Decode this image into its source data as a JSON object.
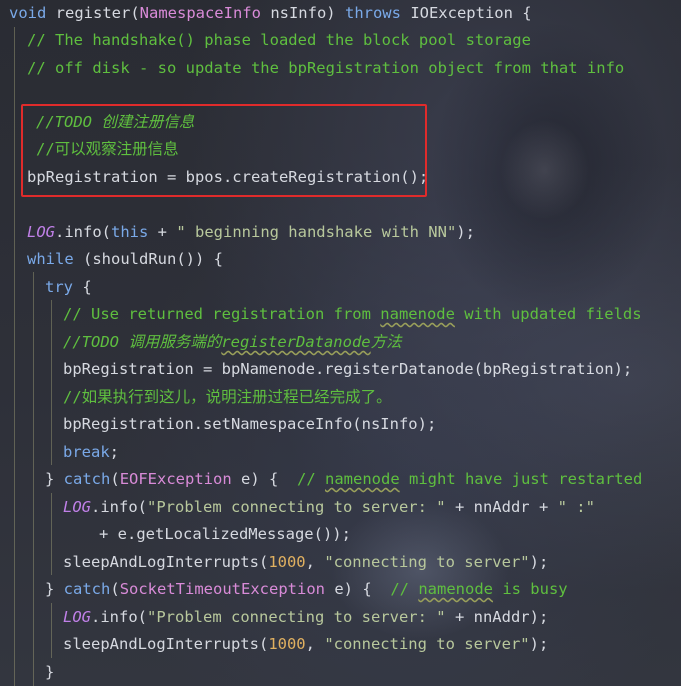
{
  "colors": {
    "background": "#2b2d36",
    "keyword": "#7aa9e8",
    "comment": "#5fbf3f",
    "type": "#d98bd8",
    "string": "#b8c89c",
    "number": "#e0b060",
    "field": "#c080e8",
    "highlight_box": "#e02b2b"
  },
  "code": {
    "l1": {
      "kw_void": "void",
      "name": " register(",
      "type": "NamespaceInfo",
      "param": " nsInfo) ",
      "kw_throws": "throws",
      "exc": " IOException {"
    },
    "l2": {
      "comment": "// The handshake() phase loaded the block pool storage"
    },
    "l3": {
      "comment": "// off disk - so update the bpRegistration object from that info"
    },
    "l4": {
      "comment": "//TODO 创建注册信息"
    },
    "l5": {
      "comment": "//可以观察注册信息"
    },
    "l6": {
      "code": "bpRegistration = bpos.createRegistration();"
    },
    "l7": {
      "field": "LOG",
      "a": ".info(",
      "kw_this": "this",
      "b": " + ",
      "str": "\" beginning handshake with NN\"",
      "c": ");"
    },
    "l8": {
      "kw": "while",
      "rest": " (shouldRun()) {"
    },
    "l9": {
      "kw": "try",
      "rest": " {"
    },
    "l10": {
      "c1": "// Use returned registration from ",
      "c2": "namenode",
      "c3": " with updated fields"
    },
    "l11": {
      "c1": "//TODO 调用服务端的",
      "c2": "registerDatanode",
      "c3": "方法"
    },
    "l12": {
      "code": "bpRegistration = bpNamenode.registerDatanode(bpRegistration);"
    },
    "l13": {
      "comment": "//如果执行到这儿，说明注册过程已经完成了。"
    },
    "l14": {
      "code": "bpRegistration.setNamespaceInfo(nsInfo);"
    },
    "l15": {
      "kw": "break",
      "rest": ";"
    },
    "l16": {
      "a": "} ",
      "kw": "catch",
      "b": "(",
      "type": "EOFException",
      "c": " e) {  ",
      "c1": "// ",
      "c2": "namenode",
      "c3": " might have just restarted"
    },
    "l17": {
      "field": "LOG",
      "a": ".info(",
      "str": "\"Problem connecting to server: \"",
      "b": " + nnAddr + ",
      "str2": "\" :\""
    },
    "l18": {
      "code": "+ e.getLocalizedMessage());"
    },
    "l19": {
      "a": "sleepAndLogInterrupts(",
      "num": "1000",
      "b": ", ",
      "str": "\"connecting to server\"",
      "c": ");"
    },
    "l20": {
      "a": "} ",
      "kw": "catch",
      "b": "(",
      "type": "SocketTimeoutException",
      "c": " e) {  ",
      "c1": "// ",
      "c2": "namenode",
      "c3": " is busy"
    },
    "l21": {
      "field": "LOG",
      "a": ".info(",
      "str": "\"Problem connecting to server: \"",
      "b": " + nnAddr);"
    },
    "l22": {
      "a": "sleepAndLogInterrupts(",
      "num": "1000",
      "b": ", ",
      "str": "\"connecting to server\"",
      "c": ");"
    },
    "l23": {
      "code": "}"
    }
  }
}
